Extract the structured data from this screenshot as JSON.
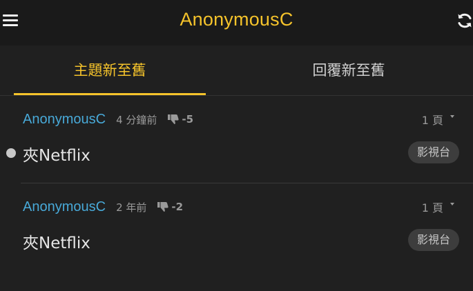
{
  "header": {
    "title": "AnonymousC",
    "menu_icon": "hamburger-menu-icon",
    "refresh_icon": "refresh-icon"
  },
  "tabs": [
    {
      "label": "主題新至舊",
      "active": true
    },
    {
      "label": "回覆新至舊",
      "active": false
    }
  ],
  "threads": [
    {
      "author": "AnonymousC",
      "time": "4 分鐘前",
      "score": "-5",
      "pages": "1 頁",
      "title": "夾Netflix",
      "tag": "影視台",
      "unread": true
    },
    {
      "author": "AnonymousC",
      "time": "2 年前",
      "score": "-2",
      "pages": "1 頁",
      "title": "夾Netflix",
      "tag": "影視台",
      "unread": false
    }
  ],
  "colors": {
    "accent": "#f5c32b",
    "author": "#48a9d8",
    "background": "#1a1a1a",
    "panel": "#202020"
  }
}
